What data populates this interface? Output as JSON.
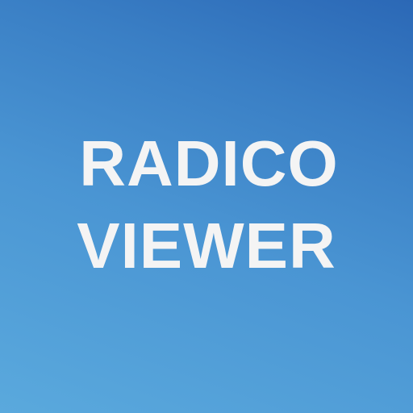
{
  "icon": {
    "line1": "RADICO",
    "line2": "VIEWER",
    "text_color": "#f4f4f4",
    "gradient_colors": [
      "#5aa9dd",
      "#4a95d3",
      "#3a7fc5",
      "#2b68b6"
    ]
  }
}
